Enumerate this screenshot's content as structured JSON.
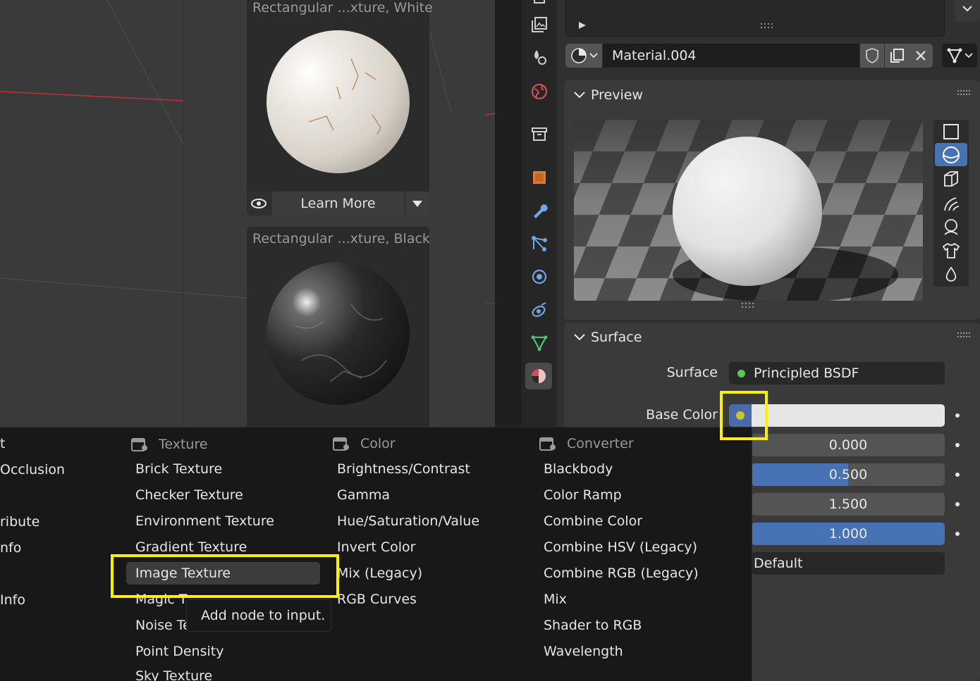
{
  "assets": [
    {
      "title": "Rectangular ...xture, White",
      "learn_more": "Learn More"
    },
    {
      "title": "Rectangular ...xture, Black"
    }
  ],
  "material": {
    "name": "Material.004"
  },
  "preview": {
    "header": "Preview"
  },
  "surface": {
    "header": "Surface",
    "surface_label": "Surface",
    "surface_value": "Principled BSDF",
    "base_color_label": "Base Color",
    "base_color_hex": "#e6e6e6",
    "values": [
      "0.000",
      "0.500",
      "1.500",
      "1.000"
    ],
    "fills": [
      0,
      0.5,
      0,
      1
    ],
    "ior_level_text": "Default"
  },
  "menu": {
    "partial_items": [
      "t",
      "Occlusion",
      "ribute",
      "nfo",
      "Info"
    ],
    "texture": {
      "header": "Texture",
      "items": [
        "Brick Texture",
        "Checker Texture",
        "Environment Texture",
        "Gradient Texture",
        "Image Texture",
        "Magic T",
        "Noise Te",
        "Point Density",
        "Sky Texture"
      ]
    },
    "color": {
      "header": "Color",
      "items": [
        "Brightness/Contrast",
        "Gamma",
        "Hue/Saturation/Value",
        "Invert Color",
        "Mix (Legacy)",
        "RGB Curves"
      ]
    },
    "converter": {
      "header": "Converter",
      "items": [
        "Blackbody",
        "Color Ramp",
        "Combine Color",
        "Combine HSV (Legacy)",
        "Combine RGB (Legacy)",
        "Mix",
        "Shader to RGB",
        "Wavelength"
      ]
    },
    "tooltip": "Add node to input."
  },
  "colors": {
    "accent": "#4772b3",
    "highlight": "#ffef00",
    "shader_dot": "#5ec35e",
    "socket_dot": "#c7c729"
  }
}
